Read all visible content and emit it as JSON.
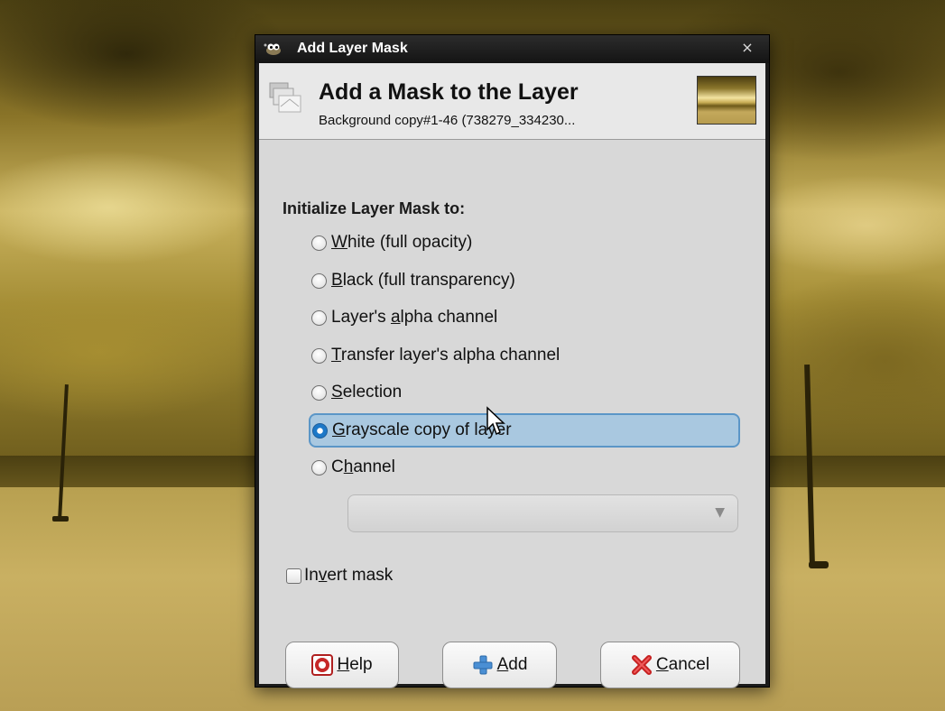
{
  "window": {
    "title": "Add Layer Mask",
    "close_symbol": "×"
  },
  "header": {
    "title": "Add a Mask to the Layer",
    "subtitle": "Background copy#1-46 (738279_334230..."
  },
  "section": {
    "label": "Initialize Layer Mask to:"
  },
  "options": [
    {
      "pre": "",
      "mn": "W",
      "post": "hite (full opacity)",
      "checked": false
    },
    {
      "pre": "",
      "mn": "B",
      "post": "lack (full transparency)",
      "checked": false
    },
    {
      "pre": "Layer's ",
      "mn": "a",
      "post": "lpha channel",
      "checked": false
    },
    {
      "pre": "",
      "mn": "T",
      "post": "ransfer layer's alpha channel",
      "checked": false
    },
    {
      "pre": "",
      "mn": "S",
      "post": "election",
      "checked": false
    },
    {
      "pre": "",
      "mn": "G",
      "post": "rayscale copy of layer",
      "checked": true
    },
    {
      "pre": "C",
      "mn": "h",
      "post": "annel",
      "checked": false
    }
  ],
  "channel_combo": {
    "value": "",
    "arrow": "▼"
  },
  "invert": {
    "pre": "In",
    "mn": "v",
    "post": "ert mask",
    "checked": false
  },
  "buttons": {
    "help": {
      "mn": "H",
      "post": "elp"
    },
    "add": {
      "mn": "A",
      "post": "dd"
    },
    "cancel": {
      "mn": "C",
      "post": "ancel"
    }
  },
  "icons": {
    "app": "gimp-wilber-icon",
    "header": "layer-mask-icon",
    "help": "lifebuoy-icon",
    "add": "plus-icon",
    "cancel": "red-x-icon"
  },
  "colors": {
    "selection_fill": "#a9c8e0",
    "selection_border": "#5b96c7",
    "radio_checked": "#1c78c8"
  }
}
